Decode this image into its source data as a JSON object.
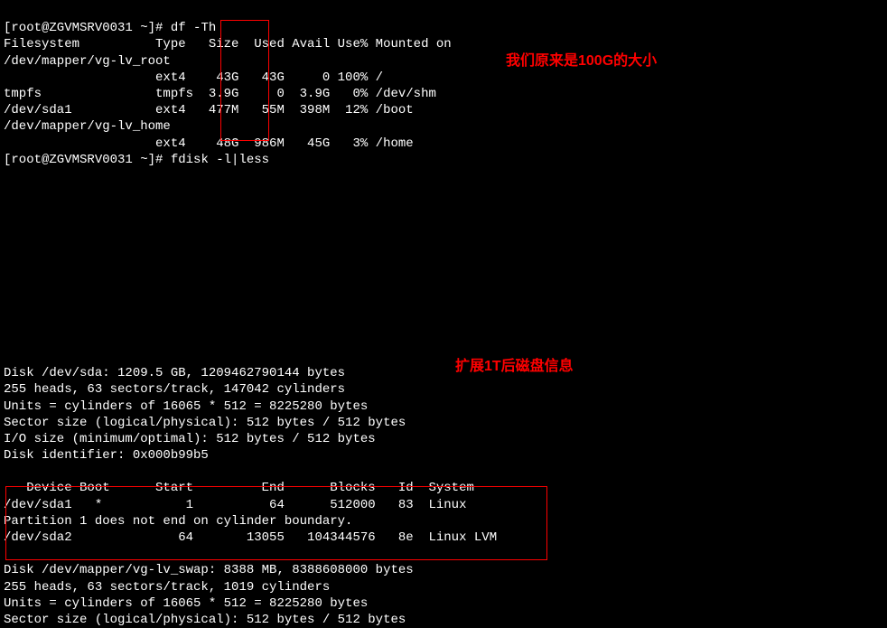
{
  "prompt1": "[root@ZGVMSRV0031 ~]#",
  "cmd1": "df -Th",
  "df": {
    "header": "Filesystem          Type   Size  Used Avail Use% Mounted on",
    "rows": [
      "/dev/mapper/vg-lv_root",
      "                    ext4    43G   43G     0 100% /",
      "tmpfs               tmpfs  3.9G     0  3.9G   0% /dev/shm",
      "/dev/sda1           ext4   477M   55M  398M  12% /boot",
      "/dev/mapper/vg-lv_home",
      "                    ext4    48G  986M   45G   3% /home"
    ]
  },
  "prompt2": "[root@ZGVMSRV0031 ~]#",
  "cmd2": "fdisk -l|less",
  "fdisk": {
    "disk_sda": [
      "Disk /dev/sda: 1209.5 GB, 1209462790144 bytes",
      "255 heads, 63 sectors/track, 147042 cylinders",
      "Units = cylinders of 16065 * 512 = 8225280 bytes",
      "Sector size (logical/physical): 512 bytes / 512 bytes",
      "I/O size (minimum/optimal): 512 bytes / 512 bytes",
      "Disk identifier: 0x000b99b5"
    ],
    "partition_table": [
      "   Device Boot      Start         End      Blocks   Id  System",
      "/dev/sda1   *           1          64      512000   83  Linux",
      "Partition 1 does not end on cylinder boundary.",
      "/dev/sda2              64       13055   104344576   8e  Linux LVM"
    ],
    "disk_swap": [
      "Disk /dev/mapper/vg-lv_swap: 8388 MB, 8388608000 bytes",
      "255 heads, 63 sectors/track, 1019 cylinders",
      "Units = cylinders of 16065 * 512 = 8225280 bytes",
      "Sector size (logical/physical): 512 bytes / 512 bytes"
    ]
  },
  "annotations": {
    "a1": "我们原来是100G的大小",
    "a2": "扩展1T后磁盘信息"
  }
}
